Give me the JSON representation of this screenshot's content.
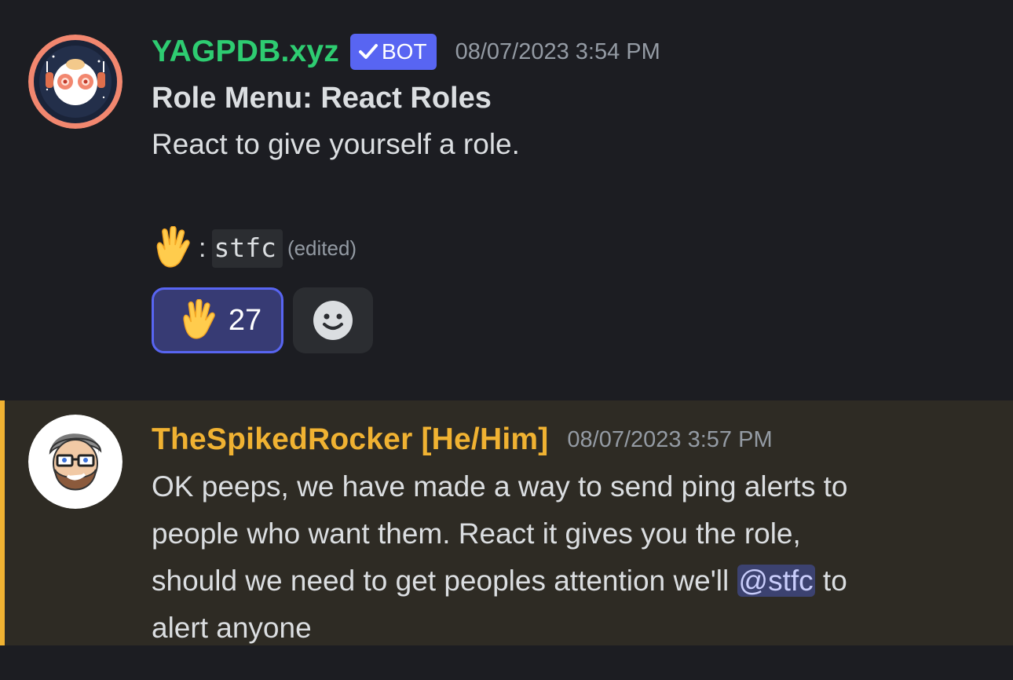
{
  "messages": [
    {
      "author": "YAGPDB.xyz",
      "author_color": "#2ecc71",
      "badge": "BOT",
      "timestamp": "08/07/2023 3:54 PM",
      "embed_title": "Role Menu: React Roles",
      "embed_text": "React to give yourself a role.",
      "role_entry": {
        "emoji": "🖖",
        "separator": ":",
        "role_code": "stfc",
        "edited": "(edited)"
      },
      "reactions": [
        {
          "emoji": "🖖",
          "count": "27",
          "active": true
        }
      ],
      "add_reaction_icon": "smile-icon"
    },
    {
      "author": "TheSpikedRocker [He/Him]",
      "author_color": "#f0b232",
      "timestamp": "08/07/2023 3:57 PM",
      "text_lines": [
        "OK peeps, we have made a way to send ping alerts to",
        "people who want them.  React it gives you the role,",
        "should we need to get peoples attention we'll",
        "alert anyone"
      ],
      "mention": "@stfc",
      "mention_suffix": " to"
    }
  ]
}
